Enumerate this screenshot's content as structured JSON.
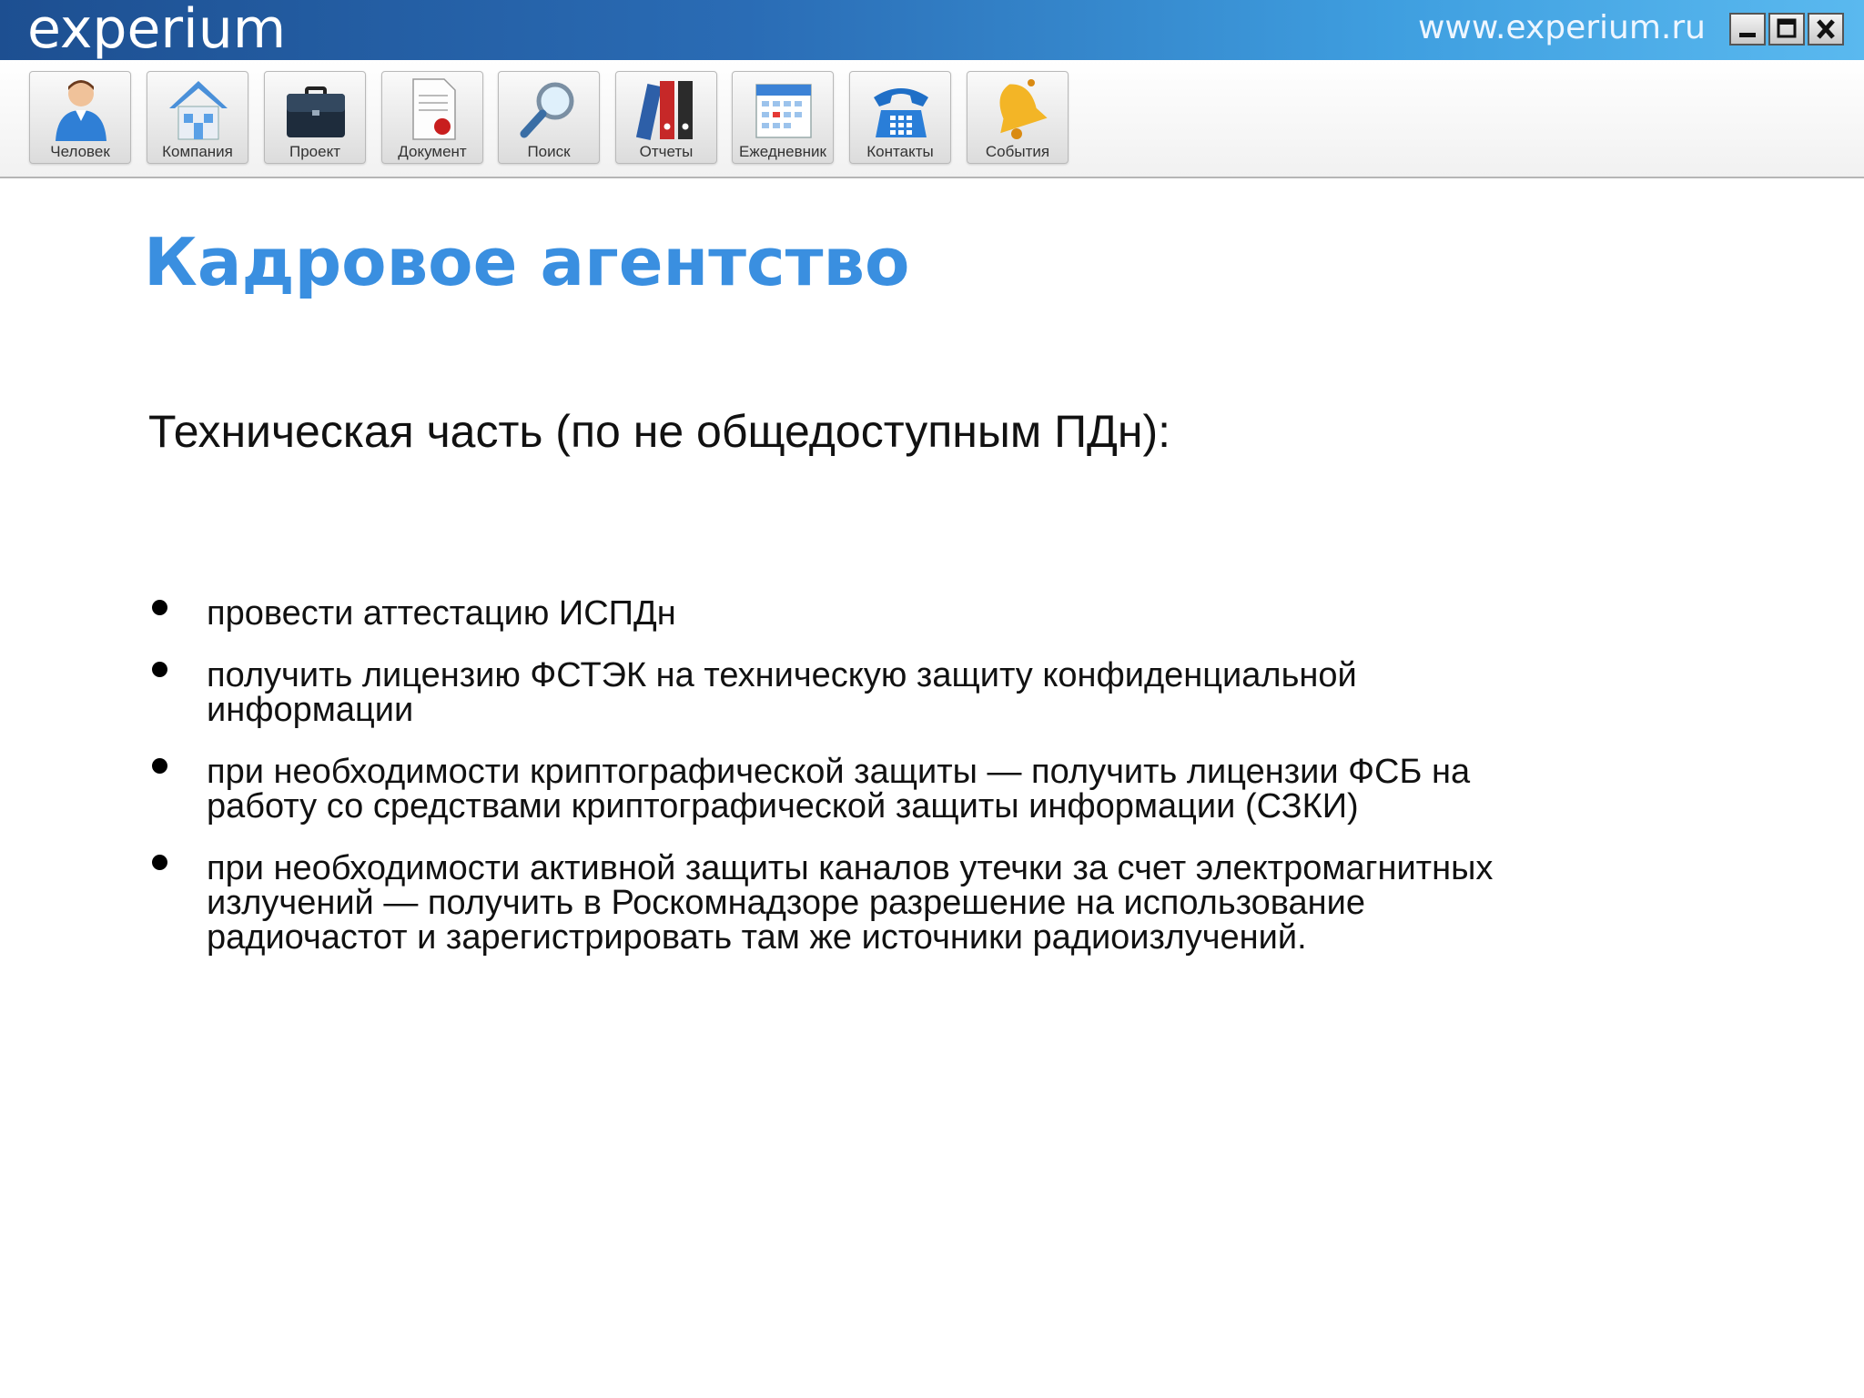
{
  "window": {
    "logo_text": "experium",
    "url_text": "www.experium.ru",
    "controls": [
      "minimize",
      "maximize",
      "close"
    ]
  },
  "toolbar": {
    "items": [
      {
        "label": "Человек",
        "icon": "person-icon"
      },
      {
        "label": "Компания",
        "icon": "house-icon"
      },
      {
        "label": "Проект",
        "icon": "briefcase-icon"
      },
      {
        "label": "Документ",
        "icon": "document-icon"
      },
      {
        "label": "Поиск",
        "icon": "magnifier-icon"
      },
      {
        "label": "Отчеты",
        "icon": "binders-icon"
      },
      {
        "label": "Ежедневник",
        "icon": "calendar-icon"
      },
      {
        "label": "Контакты",
        "icon": "telephone-icon"
      },
      {
        "label": "События",
        "icon": "bell-icon"
      }
    ]
  },
  "slide": {
    "title": "Кадровое агентство",
    "subtitle": "Техническая часть (по не общедоступным ПДн):",
    "bullets": [
      " провести аттестацию ИСПДн",
      " получить лицензию ФСТЭК на техническую защиту конфиденциальной информации",
      "при необходимости криптографической защиты — получить лицензии ФСБ на работу со средствами криптографической защиты информации (СЗКИ)",
      "при необходимости активной защиты каналов утечки за счет электромагнитных излучений — получить в Роскомнадзоре разрешение на использование радиочастот и зарегистрировать там же источники радиоизлучений."
    ]
  },
  "colors": {
    "titlebar_left": "#1d4f91",
    "titlebar_right": "#5ab9ef",
    "title_blue": "#3a8fe0",
    "text": "#111111"
  }
}
